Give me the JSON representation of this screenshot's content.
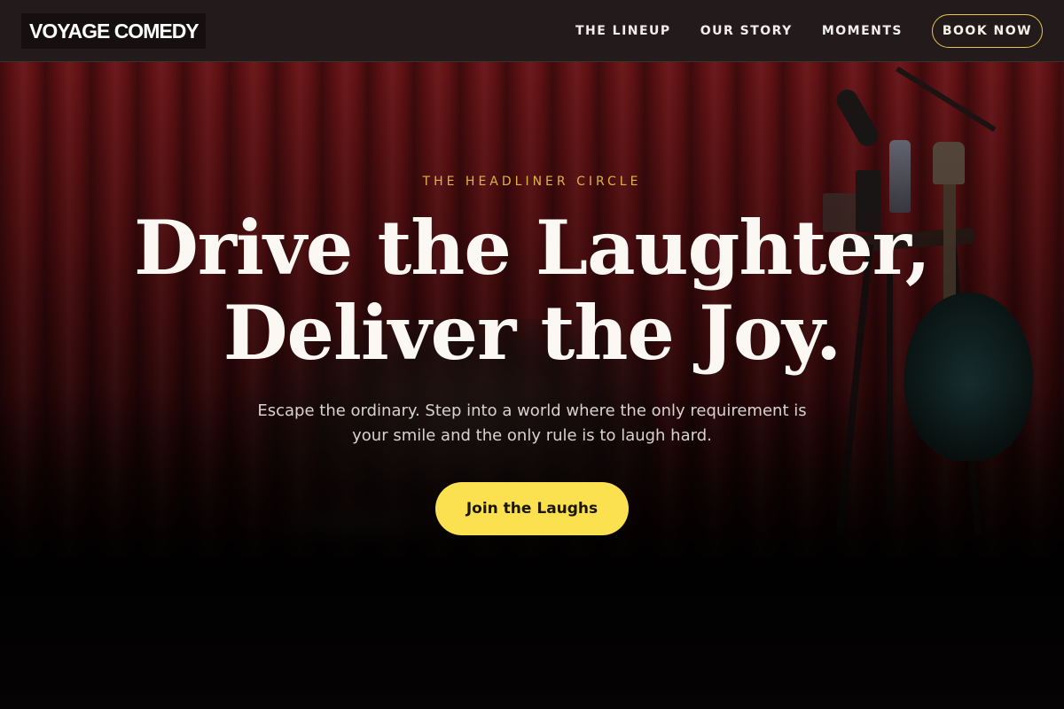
{
  "brand": {
    "logo_text": "VOYAGE COMEDY"
  },
  "nav": {
    "items": [
      {
        "label": "THE LINEUP"
      },
      {
        "label": "OUR STORY"
      },
      {
        "label": "MOMENTS"
      }
    ],
    "book_label": "BOOK NOW"
  },
  "hero": {
    "eyebrow": "THE HEADLINER CIRCLE",
    "headline_line1": "Drive the Laughter,",
    "headline_line2": "Deliver the Joy.",
    "subtext": "Escape the ordinary. Step into a world where the only requirement is your smile and the only rule is to laugh hard.",
    "cta_label": "Join the Laughs",
    "background_icon": "stage-photo"
  },
  "colors": {
    "accent_yellow": "#fbe04f",
    "eyebrow_gold": "#e2b24a",
    "nav_bg": "#231b1b",
    "curtain_red": "#6e1416"
  }
}
